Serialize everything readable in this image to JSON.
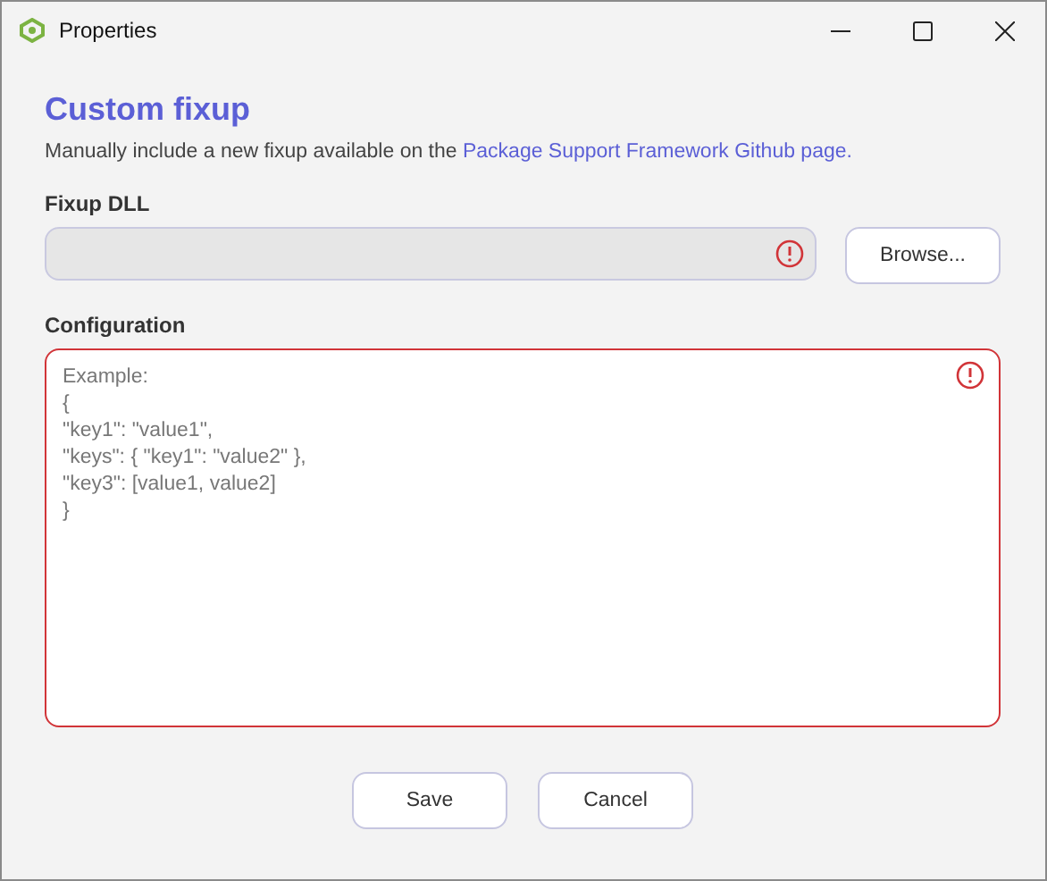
{
  "window": {
    "title": "Properties"
  },
  "heading": "Custom fixup",
  "description": {
    "text": "Manually include a new fixup available on the ",
    "link": "Package Support Framework Github page."
  },
  "fixup_dll": {
    "label": "Fixup DLL",
    "error": true,
    "disabled": true,
    "button": "Browse..."
  },
  "configuration": {
    "label": "Configuration",
    "placeholder": "Example:\n{\n\"key1\": \"value1\",\n\"keys\": { \"key1\": \"value2\" },\n\"key3\": [value1, value2]\n}",
    "error": true
  },
  "buttons": [
    "Save",
    "Cancel"
  ]
}
